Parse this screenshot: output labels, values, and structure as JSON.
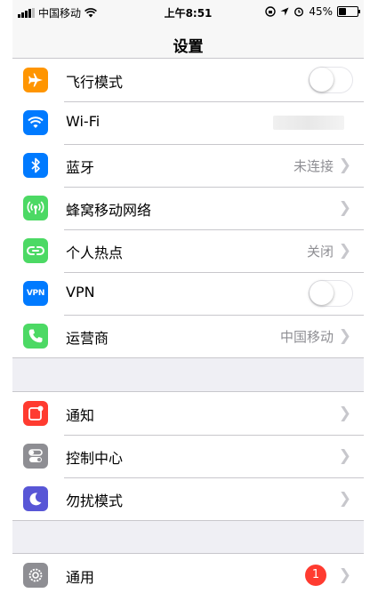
{
  "status_bar": {
    "carrier": "中国移动",
    "time": "上午8:51",
    "battery_percent": "45%",
    "battery_level": 0.45
  },
  "nav": {
    "title": "设置"
  },
  "group1": [
    {
      "label": "飞行模式",
      "icon": "airplane-icon",
      "color": "#ff9500",
      "control": "toggle",
      "toggle_on": false
    },
    {
      "label": "Wi-Fi",
      "icon": "wifi-icon",
      "color": "#007aff",
      "control": "blurred"
    },
    {
      "label": "蓝牙",
      "icon": "bluetooth-icon",
      "color": "#007aff",
      "value": "未连接"
    },
    {
      "label": "蜂窝移动网络",
      "icon": "cellular-icon",
      "color": "#4cd964"
    },
    {
      "label": "个人热点",
      "icon": "hotspot-icon",
      "color": "#4cd964",
      "value": "关闭"
    },
    {
      "label": "VPN",
      "icon_text": "VPN",
      "icon": "vpn-icon",
      "color": "#007aff",
      "control": "toggle",
      "toggle_on": false
    },
    {
      "label": "运营商",
      "icon": "phone-icon",
      "color": "#4cd964",
      "value": "中国移动"
    }
  ],
  "group2": [
    {
      "label": "通知",
      "icon": "notifications-icon",
      "color": "#ff3b30"
    },
    {
      "label": "控制中心",
      "icon": "control-center-icon",
      "color": "#8e8e93"
    },
    {
      "label": "勿扰模式",
      "icon": "moon-icon",
      "color": "#5856d6"
    }
  ],
  "group3": [
    {
      "label": "通用",
      "icon": "gear-icon",
      "color": "#8e8e93",
      "badge": "1"
    }
  ]
}
